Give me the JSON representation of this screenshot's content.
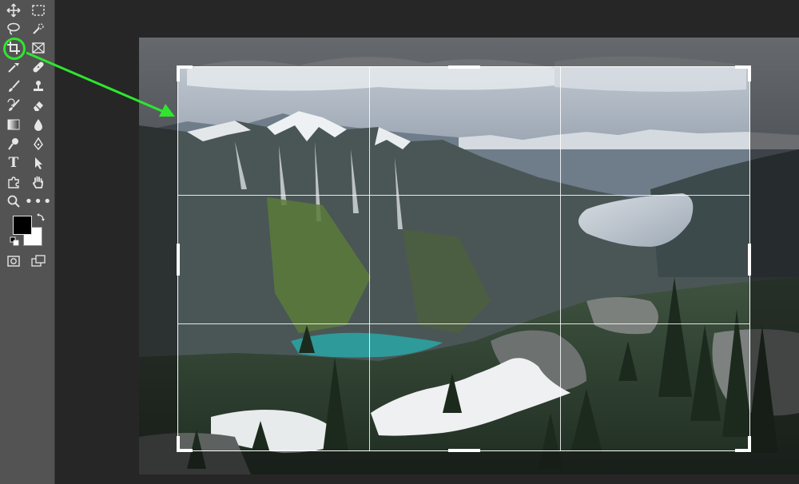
{
  "toolbar": {
    "tools": [
      {
        "name": "move-tool",
        "icon": "move-icon"
      },
      {
        "name": "marquee-tool",
        "icon": "rect-marquee-icon"
      },
      {
        "name": "lasso-tool",
        "icon": "lasso-icon"
      },
      {
        "name": "quick-selection-tool",
        "icon": "quick-selection-icon"
      },
      {
        "name": "crop-tool",
        "icon": "crop-icon",
        "active": true
      },
      {
        "name": "frame-tool",
        "icon": "frame-icon"
      },
      {
        "name": "eyedropper-tool",
        "icon": "eyedropper-icon"
      },
      {
        "name": "healing-brush-tool",
        "icon": "bandage-icon"
      },
      {
        "name": "brush-tool",
        "icon": "brush-icon"
      },
      {
        "name": "clone-stamp-tool",
        "icon": "stamp-icon"
      },
      {
        "name": "history-brush-tool",
        "icon": "history-brush-icon"
      },
      {
        "name": "eraser-tool",
        "icon": "eraser-icon"
      },
      {
        "name": "gradient-tool",
        "icon": "gradient-icon"
      },
      {
        "name": "blur-tool",
        "icon": "drop-icon"
      },
      {
        "name": "dodge-tool",
        "icon": "dodge-icon"
      },
      {
        "name": "pen-tool",
        "icon": "pen-icon"
      },
      {
        "name": "type-tool",
        "icon": "type-icon",
        "glyph": "T"
      },
      {
        "name": "path-selection-tool",
        "icon": "arrow-cursor-icon"
      },
      {
        "name": "custom-shape-tool",
        "icon": "puzzle-icon"
      },
      {
        "name": "hand-tool",
        "icon": "hand-icon"
      },
      {
        "name": "zoom-tool",
        "icon": "magnifier-icon"
      },
      {
        "name": "edit-toolbar",
        "icon": "more-icon",
        "glyph": "•••"
      },
      {
        "name": "quick-mask",
        "icon": "quick-mask-icon"
      },
      {
        "name": "screen-mode",
        "icon": "screen-mode-icon"
      }
    ],
    "foreground_color": "#000000",
    "background_color": "#ffffff"
  },
  "annotation": {
    "highlight_color": "#2ee62e",
    "arrow_color": "#2ee62e"
  },
  "canvas": {
    "document_background": "#5d5f62",
    "crop_grid": "rule-of-thirds"
  }
}
